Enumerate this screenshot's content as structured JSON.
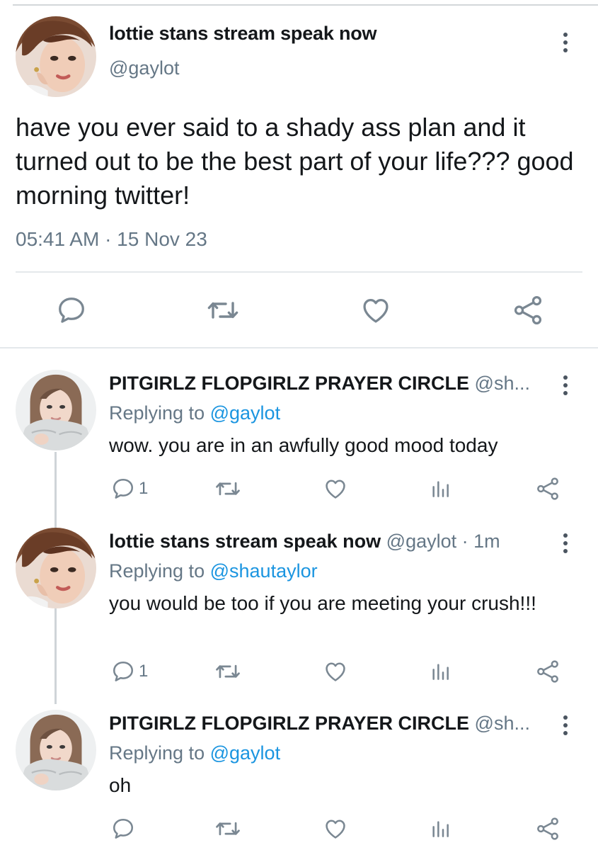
{
  "colors": {
    "text": "#14171a",
    "muted": "#657786",
    "link": "#1b95e0",
    "divider": "#e4e8eb",
    "icon": "#7a8792"
  },
  "main_tweet": {
    "display_name": "lottie stans stream speak now",
    "handle": "@gaylot",
    "text": "have you ever said to a shady ass plan and it turned out to be the best part of your life??? good morning twitter!",
    "timestamp": "05:41 AM · 15 Nov 23",
    "actions": [
      "reply-icon",
      "retweet-icon",
      "like-icon",
      "share-icon"
    ]
  },
  "replies": [
    {
      "display_name": "PITGIRLZ FLOPGIRLZ PRAYER CIRCLE",
      "handle": "@sh...",
      "replying_label": "Replying to",
      "replying_to": "@gaylot",
      "text": "wow. you are in an awfully good mood today",
      "reply_count": "1"
    },
    {
      "display_name": "lottie stans stream speak now",
      "handle": "@gaylot · 1m",
      "replying_label": "Replying to",
      "replying_to": "@shautaylor",
      "text": "you would be too if you are meeting your crush!!!",
      "reply_count": "1"
    },
    {
      "display_name": "PITGIRLZ FLOPGIRLZ PRAYER CIRCLE",
      "handle": "@sh...",
      "replying_label": "Replying to",
      "replying_to": "@gaylot",
      "text": "oh",
      "reply_count": ""
    }
  ]
}
